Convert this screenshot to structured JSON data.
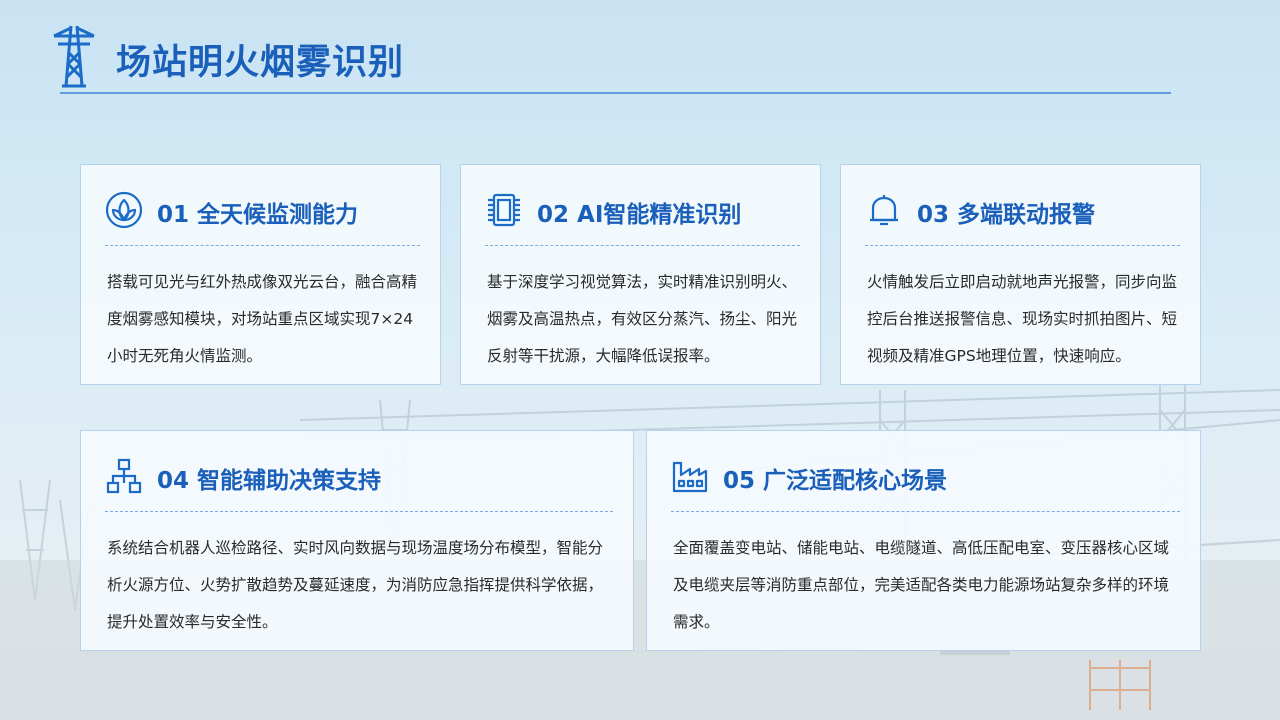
{
  "header": {
    "title": "场站明火烟雾识别",
    "icon": "power-tower-icon"
  },
  "colors": {
    "accent": "#1a5fba",
    "card_border": "#b6d3ee",
    "divider": "#7aaee0"
  },
  "cards": [
    {
      "icon": "leaf-sprout-icon",
      "title": "01 全天候监测能力",
      "body": "搭载可见光与红外热成像双光云台，融合高精度烟雾感知模块，对场站重点区域实现7×24小时无死角火情监测。"
    },
    {
      "icon": "chip-icon",
      "title": "02 AI智能精准识别",
      "body": "基于深度学习视觉算法，实时精准识别明火、烟雾及高温热点，有效区分蒸汽、扬尘、阳光反射等干扰源，大幅降低误报率。"
    },
    {
      "icon": "bell-icon",
      "title": "03 多端联动报警",
      "body": "火情触发后立即启动就地声光报警，同步向监控后台推送报警信息、现场实时抓拍图片、短视频及精准GPS地理位置，快速响应。"
    },
    {
      "icon": "hierarchy-icon",
      "title": "04 智能辅助决策支持",
      "body": "系统结合机器人巡检路径、实时风向数据与现场温度场分布模型，智能分析火源方位、火势扩散趋势及蔓延速度，为消防应急指挥提供科学依据，提升处置效率与安全性。"
    },
    {
      "icon": "factory-icon",
      "title": "05 广泛适配核心场景",
      "body": "全面覆盖变电站、储能电站、电缆隧道、高低压配电室、变压器核心区域及电缆夹层等消防重点部位，完美适配各类电力能源场站复杂多样的环境需求。"
    }
  ]
}
